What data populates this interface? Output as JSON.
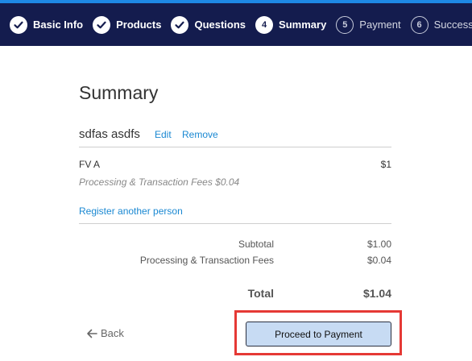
{
  "steps": [
    {
      "label": "Basic Info",
      "state": "done"
    },
    {
      "label": "Products",
      "state": "done"
    },
    {
      "label": "Questions",
      "state": "done"
    },
    {
      "label": "Summary",
      "number": "4",
      "state": "active"
    },
    {
      "label": "Payment",
      "number": "5",
      "state": "pending"
    },
    {
      "label": "Success",
      "number": "6",
      "state": "pending"
    }
  ],
  "page_title": "Summary",
  "attendee": {
    "name": "sdfas asdfs",
    "edit_label": "Edit",
    "remove_label": "Remove"
  },
  "line_item": {
    "name": "FV A",
    "price": "$1",
    "fee_note": "Processing & Transaction Fees $0.04"
  },
  "register_another_label": "Register another person",
  "summary": {
    "subtotal_label": "Subtotal",
    "subtotal_value": "$1.00",
    "fees_label": "Processing & Transaction Fees",
    "fees_value": "$0.04",
    "total_label": "Total",
    "total_value": "$1.04"
  },
  "actions": {
    "back_label": "Back",
    "proceed_label": "Proceed to Payment"
  },
  "colors": {
    "stepbar_bg": "#141c4e",
    "accent_line": "#1e88e5",
    "link": "#1a88d2",
    "proceed_bg": "#c7dbf3",
    "highlight": "#e53935"
  }
}
